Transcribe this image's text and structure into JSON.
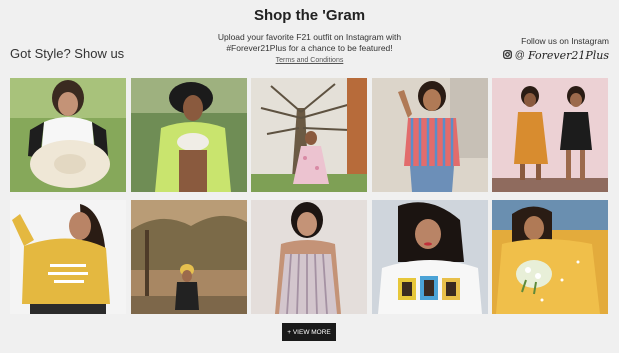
{
  "header": {
    "title": "Shop the 'Gram",
    "left_heading": "Got Style? Show us",
    "intro_line1": "Upload your favorite F21 outfit on Instagram with",
    "intro_line2": "#Forever21Plus for a chance to be featured!",
    "terms_link": "Terms and Conditions",
    "follow_label": "Follow us on Instagram",
    "at_symbol": "@",
    "handle": "Forever21Plus",
    "instagram_icon": "instagram-icon"
  },
  "gallery": {
    "tiles": [
      {
        "name": "white-top-sunhat",
        "bg": "#7fa04e",
        "accent": "#ffffff"
      },
      {
        "name": "lime-kimono",
        "bg": "#6f8c54",
        "accent": "#c8e36a"
      },
      {
        "name": "floral-maxi-tree",
        "bg": "#d9d2c6",
        "accent": "#e7b7c8"
      },
      {
        "name": "striped-shirt-jeans",
        "bg": "#d7cfc4",
        "accent": "#d85c5c"
      },
      {
        "name": "mustard-black-duo",
        "bg": "#e8c9cd",
        "accent": "#d38a2c"
      },
      {
        "name": "yellow-sweatshirt",
        "bg": "#f2f2f2",
        "accent": "#e2b53e"
      },
      {
        "name": "forest-black-outfit",
        "bg": "#9c7a56",
        "accent": "#2a2a2a"
      },
      {
        "name": "striped-pinafore",
        "bg": "#ded7d2",
        "accent": "#c9bfc5"
      },
      {
        "name": "graphic-tee",
        "bg": "#d6d9df",
        "accent": "#f6f6f6"
      },
      {
        "name": "yellow-floral-dress",
        "bg": "#e0a83a",
        "accent": "#f2c24d"
      }
    ]
  },
  "actions": {
    "view_more": "+ VIEW MORE"
  }
}
